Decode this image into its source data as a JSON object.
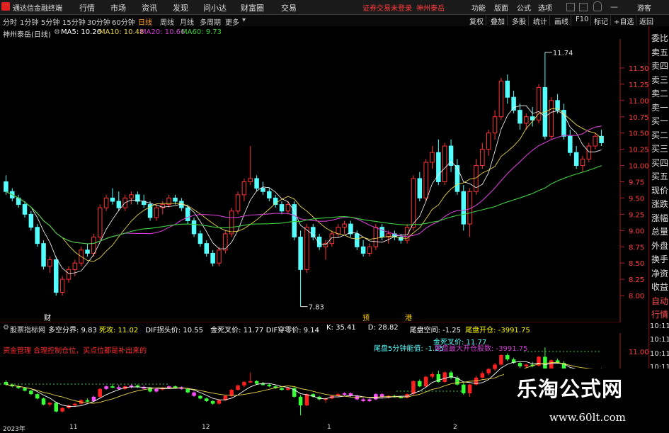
{
  "app": {
    "title": "通达信金融终端",
    "menus": [
      "行情",
      "市场",
      "资讯",
      "发现",
      "问小达",
      "财富圈",
      "交易"
    ],
    "warning": "证券交易未登录",
    "stock_tag": "神州泰岳",
    "right_menus": [
      "功能",
      "版面",
      "公式",
      "选项"
    ],
    "guest": "游客"
  },
  "toolbar": {
    "periods": [
      "分时",
      "1分钟",
      "5分钟",
      "15分钟",
      "30分钟",
      "60分钟",
      "日线",
      "周线",
      "月线",
      "多周期",
      "更多"
    ],
    "active_period": "日线",
    "right_buttons": [
      "复权",
      "叠加",
      "多股",
      "统计",
      "画线",
      "F10",
      "标记",
      "+自选",
      "返回"
    ]
  },
  "info": {
    "stock": "神州泰岳(日线)",
    "ma5": "MA5: 10.26",
    "ma10": "MA10: 10.48",
    "ma20": "MA20: 10.66",
    "ma60": "MA60: 9.73",
    "colors": {
      "ma5": "#ffffff",
      "ma10": "#e8d34a",
      "ma20": "#d03fd0",
      "ma60": "#3fd03f"
    }
  },
  "side_panel": [
    "委比",
    "卖五",
    "卖四",
    "卖三",
    "卖二",
    "卖一",
    "买一",
    "买二",
    "买三",
    "买四",
    "买五",
    "现价",
    "涨跌",
    "涨幅",
    "总量",
    "外盘",
    "换手",
    "净资",
    "收益",
    "自动",
    "行情",
    "10:11",
    "10:11",
    "10:11",
    "10:11",
    "10:11",
    "10:11",
    "10:11",
    "10:11"
  ],
  "price_axis": [
    "11.50",
    "11.25",
    "11.00",
    "10.75",
    "10.50",
    "10.25",
    "10.00",
    "9.75",
    "9.50",
    "9.25",
    "9.00",
    "8.75",
    "8.50",
    "8.25",
    "8.00"
  ],
  "annotations": {
    "high": "11.74",
    "low": "7.83",
    "marks": [
      "财",
      "预",
      "港"
    ]
  },
  "sub_info": {
    "name": "股票指标网",
    "items": [
      {
        "label": "多空分界: 9.83",
        "color": "#ffffff"
      },
      {
        "label": "死攻: 11.02",
        "color": "#ffff00"
      },
      {
        "label": "DIF拐头价: 10.55",
        "color": "#ffffff"
      },
      {
        "label": "金死叉价: 11.77",
        "color": "#ffffff"
      },
      {
        "label": "DIF穿零价: 9.14",
        "color": "#ffffff"
      },
      {
        "label": "K: 35.41",
        "color": "#ffffff"
      },
      {
        "label": "D: 28.82",
        "color": "#ffffff"
      },
      {
        "label": "尾盘空间: -1.25",
        "color": "#ffffff"
      },
      {
        "label": "尾盘开仓: -3991.75",
        "color": "#ffff00"
      }
    ]
  },
  "sub_note": "资金管理 合理控制仓位，买点位都是补出来的",
  "sub_labels": {
    "a": "尾盘5分钟能值: -1.25",
    "b": "金死叉价: 11.77",
    "c": "尾盘最大开仓股数: -3991.75",
    "price": "11.00"
  },
  "bottom_axis": [
    "2023年",
    "11",
    "12",
    "1",
    "2"
  ],
  "watermark": {
    "title": "乐淘公式网",
    "url": "www.60lt.com"
  },
  "chart_data": {
    "type": "candlestick",
    "ylim": [
      7.75,
      11.75
    ],
    "candles": [
      [
        9.75,
        9.85,
        9.55,
        9.6
      ],
      [
        9.6,
        9.65,
        9.45,
        9.5
      ],
      [
        9.5,
        9.55,
        9.35,
        9.4
      ],
      [
        9.4,
        9.45,
        9.2,
        9.25
      ],
      [
        9.25,
        9.3,
        9.0,
        9.05
      ],
      [
        9.05,
        9.1,
        8.75,
        8.8
      ],
      [
        8.8,
        8.85,
        8.4,
        8.45
      ],
      [
        8.45,
        8.6,
        8.35,
        8.55
      ],
      [
        8.55,
        8.6,
        8.0,
        8.05
      ],
      [
        8.05,
        8.3,
        8.0,
        8.25
      ],
      [
        8.25,
        8.45,
        8.2,
        8.4
      ],
      [
        8.4,
        8.55,
        8.3,
        8.5
      ],
      [
        8.5,
        8.75,
        8.45,
        8.7
      ],
      [
        8.7,
        8.8,
        8.6,
        8.65
      ],
      [
        8.65,
        8.95,
        8.6,
        8.9
      ],
      [
        8.9,
        9.4,
        8.85,
        9.35
      ],
      [
        9.35,
        9.55,
        9.3,
        9.5
      ],
      [
        9.5,
        9.65,
        9.4,
        9.45
      ],
      [
        9.45,
        9.6,
        9.3,
        9.35
      ],
      [
        9.35,
        9.55,
        9.3,
        9.5
      ],
      [
        9.5,
        9.6,
        9.4,
        9.55
      ],
      [
        9.55,
        9.6,
        9.4,
        9.45
      ],
      [
        9.45,
        9.55,
        9.35,
        9.4
      ],
      [
        9.4,
        9.45,
        9.15,
        9.2
      ],
      [
        9.2,
        9.4,
        9.15,
        9.35
      ],
      [
        9.35,
        9.45,
        9.25,
        9.4
      ],
      [
        9.4,
        9.55,
        9.35,
        9.5
      ],
      [
        9.5,
        9.55,
        9.4,
        9.45
      ],
      [
        9.45,
        9.5,
        9.3,
        9.35
      ],
      [
        9.35,
        9.4,
        9.1,
        9.15
      ],
      [
        9.15,
        9.2,
        8.9,
        8.95
      ],
      [
        8.95,
        9.0,
        8.75,
        8.8
      ],
      [
        8.8,
        8.85,
        8.6,
        8.65
      ],
      [
        8.65,
        8.7,
        8.45,
        8.5
      ],
      [
        8.5,
        8.75,
        8.45,
        8.7
      ],
      [
        8.7,
        9.0,
        8.65,
        8.95
      ],
      [
        8.95,
        9.35,
        8.9,
        9.3
      ],
      [
        9.3,
        9.6,
        9.25,
        9.55
      ],
      [
        9.55,
        9.8,
        9.45,
        9.75
      ],
      [
        9.75,
        10.3,
        9.7,
        9.8
      ],
      [
        9.8,
        9.85,
        9.6,
        9.65
      ],
      [
        9.65,
        9.75,
        9.55,
        9.6
      ],
      [
        9.6,
        9.65,
        9.45,
        9.5
      ],
      [
        9.5,
        9.55,
        9.35,
        9.4
      ],
      [
        9.4,
        9.45,
        9.25,
        9.3
      ],
      [
        9.3,
        9.45,
        9.25,
        9.4
      ],
      [
        9.4,
        9.45,
        8.85,
        8.9
      ],
      [
        8.9,
        9.0,
        7.83,
        8.4
      ],
      [
        8.4,
        9.1,
        8.35,
        9.05
      ],
      [
        9.05,
        9.1,
        8.85,
        8.9
      ],
      [
        8.9,
        8.95,
        8.7,
        8.75
      ],
      [
        8.75,
        8.85,
        8.55,
        8.8
      ],
      [
        8.8,
        9.0,
        8.75,
        8.95
      ],
      [
        8.95,
        9.1,
        8.9,
        9.05
      ],
      [
        9.05,
        9.15,
        8.95,
        9.1
      ],
      [
        9.1,
        9.15,
        8.9,
        8.95
      ],
      [
        8.95,
        9.0,
        8.7,
        8.75
      ],
      [
        8.75,
        8.85,
        8.6,
        8.65
      ],
      [
        8.65,
        8.8,
        8.6,
        8.75
      ],
      [
        8.75,
        9.1,
        8.7,
        9.05
      ],
      [
        9.05,
        9.1,
        8.85,
        8.9
      ],
      [
        8.9,
        9.0,
        8.8,
        8.95
      ],
      [
        8.95,
        9.0,
        8.85,
        8.9
      ],
      [
        8.9,
        8.95,
        8.8,
        8.85
      ],
      [
        8.85,
        9.1,
        8.8,
        9.05
      ],
      [
        9.05,
        9.85,
        9.0,
        9.8
      ],
      [
        9.8,
        9.9,
        9.45,
        9.5
      ],
      [
        9.5,
        10.1,
        9.45,
        10.05
      ],
      [
        10.05,
        10.3,
        9.95,
        10.2
      ],
      [
        10.2,
        10.4,
        9.7,
        9.75
      ],
      [
        9.75,
        10.35,
        9.7,
        10.3
      ],
      [
        10.3,
        10.4,
        9.9,
        10.0
      ],
      [
        10.0,
        10.1,
        9.55,
        9.6
      ],
      [
        9.6,
        9.7,
        9.0,
        9.1
      ],
      [
        9.1,
        9.65,
        8.9,
        9.6
      ],
      [
        9.6,
        10.1,
        9.55,
        10.0
      ],
      [
        10.0,
        10.35,
        9.95,
        10.25
      ],
      [
        10.25,
        10.55,
        10.15,
        10.5
      ],
      [
        10.5,
        10.85,
        10.4,
        10.75
      ],
      [
        10.75,
        11.35,
        10.7,
        11.3
      ],
      [
        11.3,
        11.4,
        10.95,
        11.05
      ],
      [
        11.05,
        11.15,
        10.8,
        10.85
      ],
      [
        10.85,
        10.95,
        10.55,
        10.65
      ],
      [
        10.65,
        10.8,
        10.55,
        10.75
      ],
      [
        10.75,
        10.9,
        10.6,
        10.7
      ],
      [
        10.7,
        11.25,
        10.65,
        11.2
      ],
      [
        11.2,
        11.74,
        10.4,
        10.45
      ],
      [
        10.45,
        11.05,
        10.4,
        11.0
      ],
      [
        11.0,
        11.1,
        10.8,
        10.85
      ],
      [
        10.85,
        10.95,
        10.4,
        10.45
      ],
      [
        10.45,
        10.55,
        10.15,
        10.2
      ],
      [
        10.2,
        10.3,
        9.95,
        10.0
      ],
      [
        10.0,
        10.15,
        9.9,
        10.1
      ],
      [
        10.1,
        10.35,
        10.05,
        10.3
      ],
      [
        10.3,
        10.5,
        10.25,
        10.45
      ],
      [
        10.45,
        10.55,
        10.3,
        10.35
      ]
    ]
  }
}
